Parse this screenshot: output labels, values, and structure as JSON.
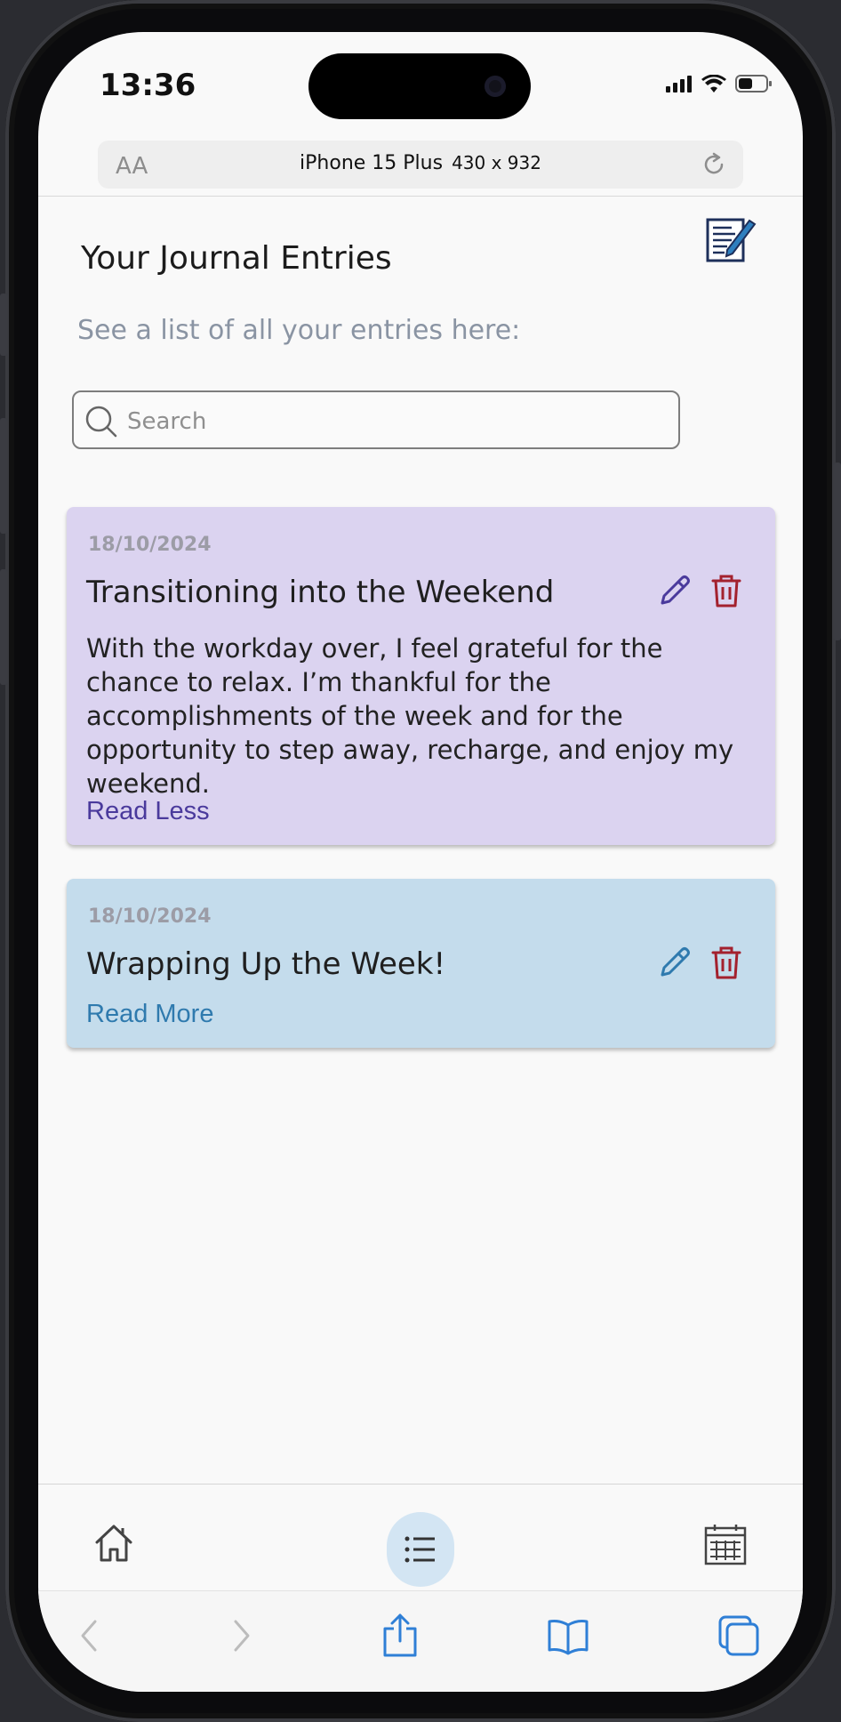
{
  "status_bar": {
    "time": "13:36"
  },
  "browser": {
    "url_aa": "AA",
    "device_name": "iPhone 15 Plus",
    "device_size": "430 x 932"
  },
  "page": {
    "title": "Your Journal Entries",
    "subtitle": "See a list of all your entries here:",
    "search": {
      "placeholder": "Search",
      "value": ""
    }
  },
  "entries": [
    {
      "date": "18/10/2024",
      "title": "Transitioning into the Weekend",
      "body": "With the workday over, I feel grateful for the chance to relax. I’m thankful for the accomplishments of the week and for the opportunity to step away, recharge, and enjoy my weekend.",
      "toggle_label": "Read Less",
      "background": "#dbd3f0",
      "edit_color": "#4a3a9c"
    },
    {
      "date": "18/10/2024",
      "title": "Wrapping Up the Week!",
      "toggle_label": "Read More",
      "background": "#c4dcec",
      "edit_color": "#2f7aae"
    }
  ],
  "colors": {
    "delete": "#a3212e",
    "active_tab_bg": "#d3e5f3",
    "browser_accent": "#2f7fd6"
  },
  "icons": {
    "header": "new-entry-icon",
    "tabs": [
      "home-icon",
      "list-icon",
      "calendar-icon"
    ],
    "browser_toolbar": [
      "back-icon",
      "forward-icon",
      "share-icon",
      "bookmarks-icon",
      "tabs-icon"
    ]
  }
}
